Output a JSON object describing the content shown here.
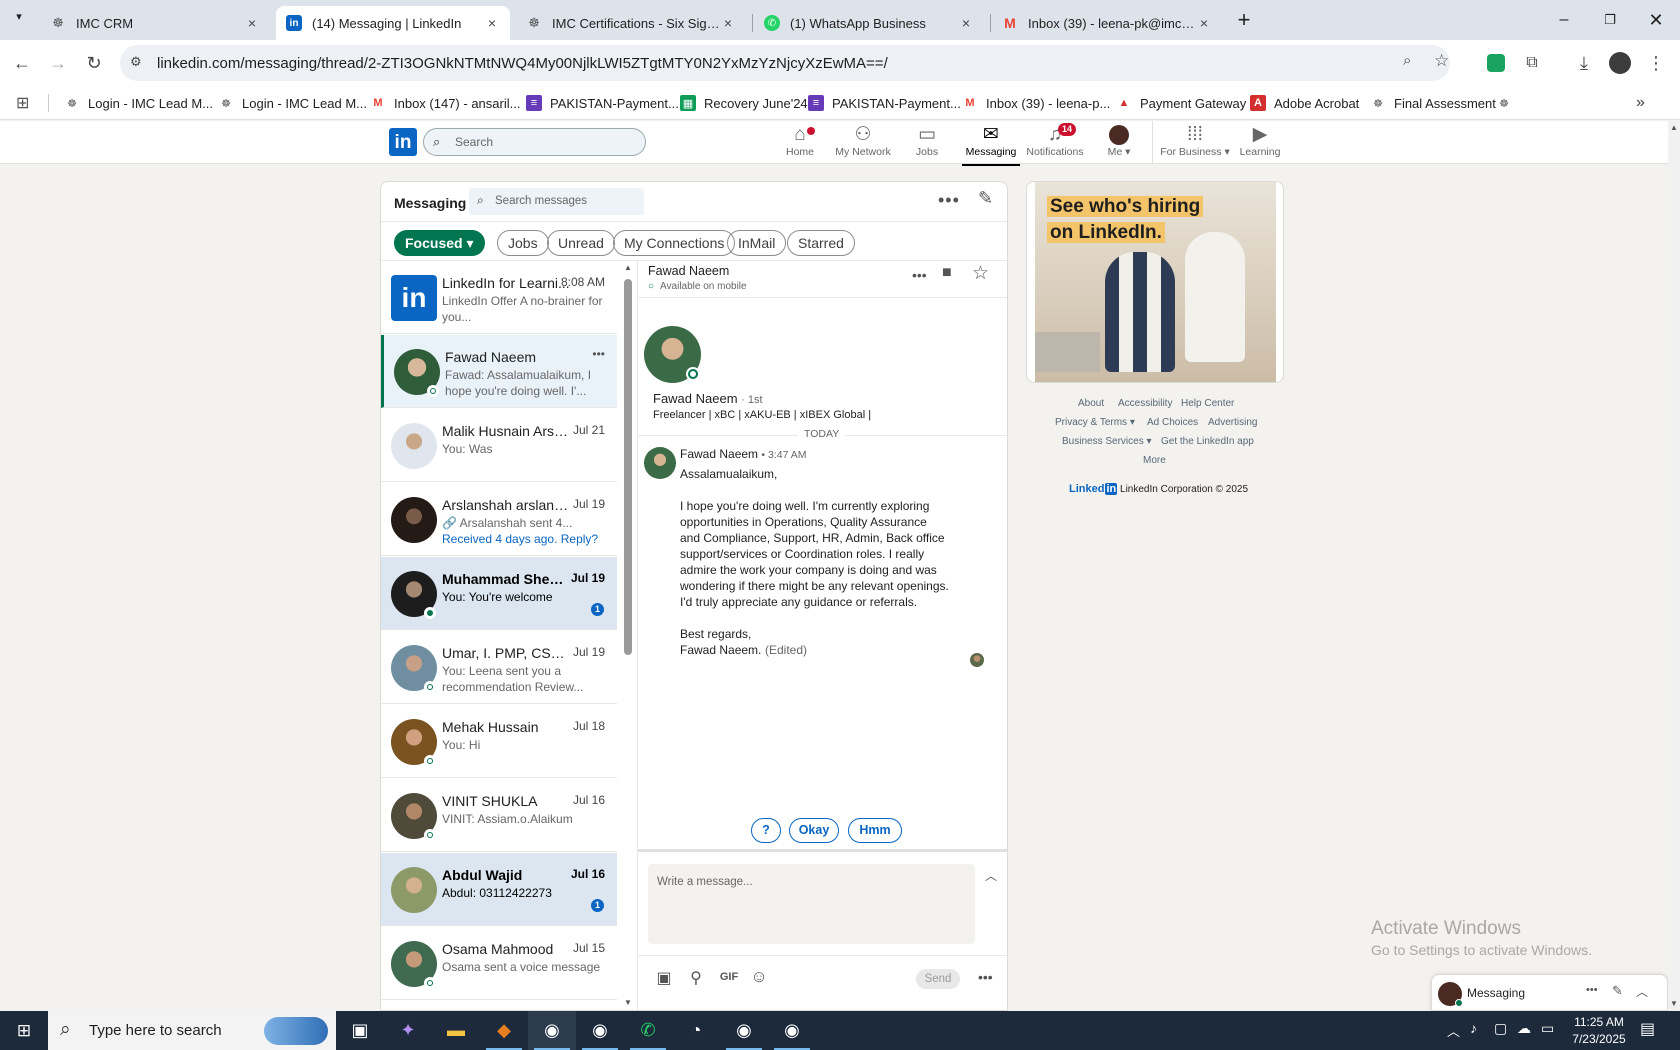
{
  "browser": {
    "tabs": [
      {
        "title": "IMC CRM",
        "favicon": "seal-icon",
        "active": false
      },
      {
        "title": "(14) Messaging | LinkedIn",
        "favicon": "linkedin-icon",
        "active": true
      },
      {
        "title": "IMC Certifications - Six Sigma G",
        "favicon": "seal-icon",
        "active": false
      },
      {
        "title": "(1) WhatsApp Business",
        "favicon": "whatsapp-icon",
        "active": false
      },
      {
        "title": "Inbox (39) - leena-pk@imccertif",
        "favicon": "gmail-icon",
        "active": false
      }
    ],
    "url": "linkedin.com/messaging/thread/2-ZTI3OGNkNTMtNWQ4My00NjlkLWI5ZTgtMTY0N2YxMzYzNjcyXzEwMA==/",
    "bookmarks": [
      {
        "label": "Login - IMC Lead M...",
        "icon": "seal-icon"
      },
      {
        "label": "Login - IMC Lead M...",
        "icon": "seal-icon"
      },
      {
        "label": "Inbox (147) - ansaril...",
        "icon": "gmail-icon"
      },
      {
        "label": "PAKISTAN-Payment...",
        "icon": "form-icon"
      },
      {
        "label": "Recovery June'24",
        "icon": "sheets-icon"
      },
      {
        "label": "PAKISTAN-Payment...",
        "icon": "form-icon"
      },
      {
        "label": "Inbox (39) - leena-p...",
        "icon": "gmail-icon"
      },
      {
        "label": "Payment Gateway",
        "icon": "arrow-icon"
      },
      {
        "label": "Adobe Acrobat",
        "icon": "acrobat-icon"
      },
      {
        "label": "Final Assessment",
        "icon": "seal-icon"
      }
    ]
  },
  "linkedin": {
    "search_placeholder": "Search",
    "nav": [
      {
        "label": "Home",
        "icon": "home-icon",
        "badge": ""
      },
      {
        "label": "My Network",
        "icon": "network-icon",
        "badge": ""
      },
      {
        "label": "Jobs",
        "icon": "briefcase-icon",
        "badge": ""
      },
      {
        "label": "Messaging",
        "icon": "messaging-icon",
        "badge": "",
        "active": true
      },
      {
        "label": "Notifications",
        "icon": "bell-icon",
        "badge": "14"
      },
      {
        "label": "Me",
        "icon": "avatar",
        "badge": ""
      },
      {
        "label": "For Business",
        "icon": "grid-icon",
        "badge": ""
      },
      {
        "label": "Learning",
        "icon": "play-icon",
        "badge": ""
      }
    ]
  },
  "messaging": {
    "title": "Messaging",
    "search_placeholder": "Search messages",
    "filters": [
      "Focused",
      "Jobs",
      "Unread",
      "My Connections",
      "InMail",
      "Starred"
    ],
    "conversations": [
      {
        "name": "LinkedIn for Learni...",
        "date": "8:08 AM",
        "preview": "LinkedIn Offer  A no-brainer for you...",
        "avatar": "#0a66c2",
        "status": "none",
        "badge": "",
        "state": "normal"
      },
      {
        "name": "Fawad Naeem",
        "date": "",
        "preview": "Fawad: Assalamualaikum, I hope you're doing well. I'...",
        "avatar": "#6c7b5a",
        "status": "ring",
        "badge": "",
        "state": "selected"
      },
      {
        "name": "Malik Husnain Arshad",
        "date": "Jul 21",
        "preview": "You: Was",
        "avatar": "#b9c4d0",
        "status": "none",
        "badge": "",
        "state": "normal"
      },
      {
        "name": "Arslanshah arslans...",
        "date": "Jul 19",
        "preview": "🔗 Arsalanshah sent 4...",
        "extra": "Received 4 days ago. Reply?",
        "avatar": "#3a2a22",
        "status": "none",
        "badge": "",
        "state": "normal"
      },
      {
        "name": "Muhammad Shehro...",
        "date": "Jul 19",
        "preview": "You: You're welcome",
        "avatar": "#2b2b2b",
        "status": "full",
        "badge": "1",
        "state": "unread"
      },
      {
        "name": "Umar, I. PMP, CSCP®...",
        "date": "Jul 19",
        "preview": "You: Leena sent you a recommendation Review...",
        "avatar": "#5a7a8a",
        "status": "ring",
        "badge": "",
        "state": "normal"
      },
      {
        "name": "Mehak Hussain",
        "date": "Jul 18",
        "preview": "You: Hi",
        "avatar": "#8a6a3a",
        "status": "ring",
        "badge": "",
        "state": "normal"
      },
      {
        "name": "VINIT SHUKLA",
        "date": "Jul 16",
        "preview": "VINIT: Assiam.o.Alaikum",
        "avatar": "#6a5a4a",
        "status": "ring",
        "badge": "",
        "state": "normal"
      },
      {
        "name": "Abdul Wajid",
        "date": "Jul 16",
        "preview": "Abdul: 03112422273",
        "avatar": "#8a8a6a",
        "status": "none",
        "badge": "1",
        "state": "unread"
      },
      {
        "name": "Osama Mahmood",
        "date": "Jul 15",
        "preview": "Osama sent a voice message",
        "avatar": "#4a6a5a",
        "status": "ring",
        "badge": "",
        "state": "normal"
      }
    ],
    "thread": {
      "name": "Fawad Naeem",
      "status": "Available on mobile",
      "profile_name": "Fawad Naeem",
      "degree": "· 1st",
      "headline": "Freelancer | xBC | xAKU-EB | xIBEX Global |",
      "day_divider": "TODAY",
      "msg_sender": "Fawad Naeem",
      "msg_time": "• 3:47 AM",
      "msg_body": "Assalamualaikum,\n\nI hope you're doing well. I'm currently exploring opportunities in Operations, Quality Assurance and Compliance, Support, HR, Admin, Back office support/services or Coordination roles. I really admire the work your company is doing and was wondering if there might be any relevant openings. I'd truly appreciate any guidance or referrals.\n\nBest regards,\nFawad Naeem.",
      "msg_edited": "(Edited)",
      "quick_replies": [
        "?",
        "Okay",
        "Hmm"
      ],
      "compose_placeholder": "Write a message...",
      "send_label": "Send",
      "gif_label": "GIF"
    }
  },
  "ad": {
    "headline_line1": "See who's hiring",
    "headline_line2": "on LinkedIn."
  },
  "footer": {
    "links_row1": [
      "About",
      "Accessibility",
      "Help Center"
    ],
    "links_row2": [
      "Privacy & Terms ▾",
      "Ad Choices",
      "Advertising"
    ],
    "links_row3": [
      "Business Services ▾",
      "Get the LinkedIn app"
    ],
    "more": "More",
    "brand": "Linked",
    "brand_in": "in",
    "copyright": "LinkedIn Corporation © 2025"
  },
  "minibar": {
    "label": "Messaging"
  },
  "watermark": {
    "line1": "Activate Windows",
    "line2": "Go to Settings to activate Windows."
  },
  "taskbar": {
    "search_placeholder": "Type here to search",
    "time": "11:25 AM",
    "date": "7/23/2025"
  }
}
